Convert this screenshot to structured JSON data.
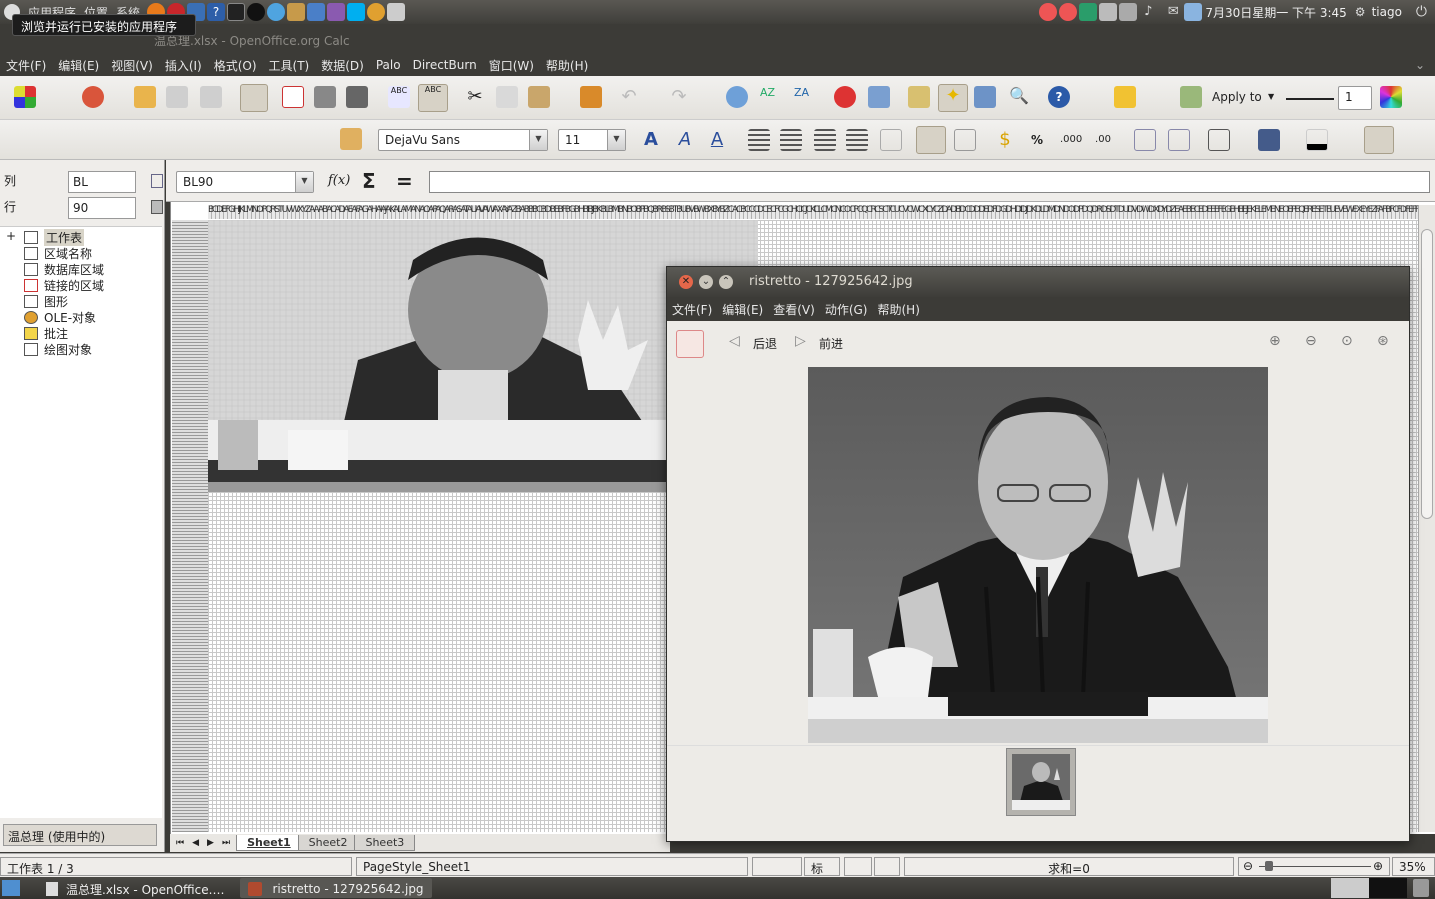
{
  "top_panel": {
    "menus": [
      "应用程序",
      "位置",
      "系统"
    ],
    "tooltip": "浏览并运行已安装的应用程序",
    "clock": "7月30日星期一 下午 3:45",
    "user": "tiago"
  },
  "calc": {
    "window_title": "温总理.xlsx - OpenOffice.org Calc",
    "menu": [
      "文件(F)",
      "编辑(E)",
      "视图(V)",
      "插入(I)",
      "格式(O)",
      "工具(T)",
      "数据(D)",
      "Palo",
      "DirectBurn",
      "窗口(W)",
      "帮助(H)"
    ],
    "toolbar": {
      "apply_to": "Apply to",
      "line_width": "1",
      "font_name": "DejaVu Sans",
      "font_size": "11"
    },
    "navigator": {
      "col_label": "列",
      "col_value": "BL",
      "row_label": "行",
      "row_value": "90",
      "tree": [
        "工作表",
        "区域名称",
        "数据库区域",
        "链接的区域",
        "图形",
        "OLE-对象",
        "批注",
        "绘图对象"
      ],
      "doc_select": "温总理 (使用中的)"
    },
    "formula_bar": {
      "name_box": "BL90",
      "fx": "f(x)",
      "sum": "Σ",
      "equals": "=",
      "content": ""
    },
    "column_letters": "BCDEFGHIJKLMNOPQRSTUVWXYZAAABACADAEAFAGAHAIAJAKALAMANAOAPAQARASATAUAVAWAXAYAZBABBBCBDBEBFBGBHBIBJBKBLBMBNBOBPBQBRBSBTBUBVBWBXBYBZCACBCCCDCECFCGCHCICJCKCLCMCNCOCPCQCRCSCTCUCVCWCXCYCZDADBDCDDDEDFDGDHDIDJDKDLDMDNDODPDQDRDSDTDUDVDWDXDYDZEAEBECEDEEEFEGEHEIEJEKELEMENEOEPEQERESETEUEVEWEXEYEZFAFBFCFDFEFFFGFHFIFJFKFL",
    "sheets": [
      "Sheet1",
      "Sheet2",
      "Sheet3"
    ],
    "status": {
      "sheet": "工作表 1 / 3",
      "page_style": "PageStyle_Sheet1",
      "mode": "标准",
      "sum": "求和=0",
      "zoom": "35%"
    }
  },
  "ristretto": {
    "title": "ristretto - 127925642.jpg",
    "menu": [
      "文件(F)",
      "编辑(E)",
      "查看(V)",
      "动作(G)",
      "帮助(H)"
    ],
    "back": "后退",
    "forward": "前进"
  },
  "taskbar": {
    "items": [
      "温总理.xlsx - OpenOffice.…",
      "ristretto - 127925642.jpg"
    ]
  }
}
